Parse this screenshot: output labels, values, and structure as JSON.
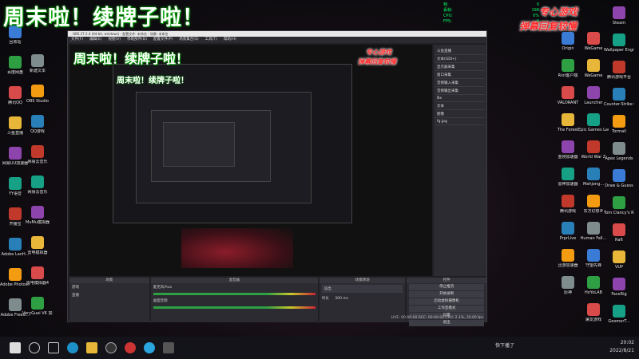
{
  "overlay": {
    "main_text": "周末啦！续牌子啦！",
    "stamp_text_1": "专心游戏",
    "stamp_text_2": "弹幕回复较慢"
  },
  "stats": [
    {
      "label": "帧:",
      "value": "0"
    },
    {
      "label": "丢帧:",
      "value": "198"
    },
    {
      "label": "CPU:",
      "value": "0%"
    },
    {
      "label": "FPS:",
      "value": "0"
    }
  ],
  "desktop_left": [
    "回收站",
    "百度网盘",
    "腾讯QQ",
    "斗鱼直播",
    "网易UU加速器",
    "YY语音",
    "开播宝",
    "Adobe LanH...",
    "Adobe Photosh...",
    "Adobe Freesi..."
  ],
  "desktop_left2": [
    "新建文本",
    "OBS Studio",
    "QQ游戏",
    "网易云音乐",
    "网易云音乐",
    "MuMu模拟器",
    "雷电模拟器",
    "雷电模拟器4",
    "VeryGuai VK 加速器"
  ],
  "desktop_right": [
    "Origin",
    "Riot客户端",
    "VALORANT",
    "The Forest",
    "金刚加速器",
    "雷神加速器",
    "腾讯游戏",
    "PrprLive",
    "迅游加速器",
    "原神"
  ],
  "desktop_right2": [
    "WeGame",
    "WeGame",
    "Launcher",
    "Epic Games Launcher",
    "World War Z",
    "Mahjong...",
    "东方幻想乡",
    "Human Fall...",
    "守望先锋",
    "HoYoLAB",
    "屠龙游戏"
  ],
  "desktop_right3": [
    "Steam",
    "Wallpaper Engine",
    "腾讯游戏平台",
    "Counter-Strike Global Off...",
    "Tormall",
    "Apex Legends",
    "Draw & Guess",
    "Tom Clancy's R...",
    "Raft",
    "VUP",
    "FaceRig",
    "GeomorT..."
  ],
  "obs": {
    "title": "OBS 27.2.4 (64-bit, windows) - 配置文件: 未命名 - 场景: 未命名",
    "menu": [
      "文件(F)",
      "编辑(E)",
      "视图(V)",
      "停靠部件(D)",
      "配置文件(P)",
      "场景集合(S)",
      "工具(T)",
      "帮助(H)"
    ],
    "sources": [
      "斗鱼直播",
      "文本(GDI+)",
      "显示器采集",
      "窗口采集",
      "音频输入采集",
      "音频输出采集",
      "Nx",
      "文本",
      "图像",
      "fg.jpg"
    ],
    "docks": {
      "scenes_header": "场景",
      "mixer_header": "混音器",
      "transitions_header": "场景转场",
      "controls_header": "控件",
      "scene_item_1": "游戏",
      "scene_item_2": "直播",
      "audio_1": "麦克风/Aux",
      "audio_2": "桌面音频",
      "transition_value": "淡出",
      "duration_label": "时长",
      "duration_value": "300 ms",
      "controls": [
        "停止推流",
        "开始录制",
        "启动虚拟摄像机",
        "工作室模式",
        "设置",
        "退出"
      ]
    },
    "status": "LIVE: 00:00:00   REC: 00:00:00   CPU: 2.1%, 30.00 fps"
  },
  "taskbar": {
    "tray_text": "快下播了",
    "time": "20:02",
    "date": "2022/8/21"
  }
}
